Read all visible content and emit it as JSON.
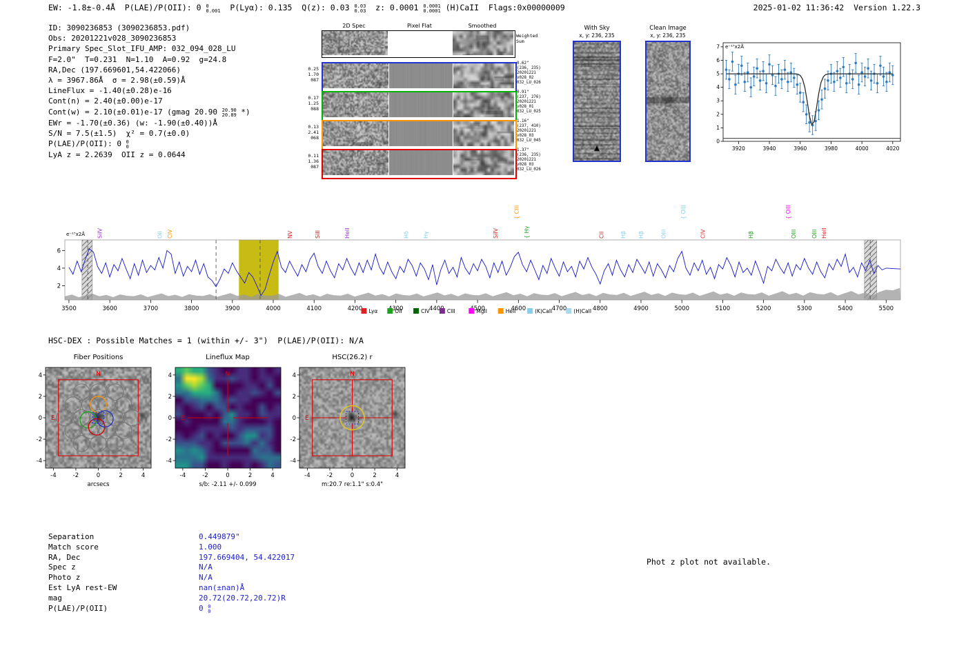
{
  "meta": {
    "datetime": "2025-01-02 11:36:42",
    "version": "Version 1.22.3"
  },
  "header": {
    "segments": [
      {
        "t": "EW: -1.8±-0.4Å  P(LAE)/P(OII): 0 "
      },
      {
        "frac": [
          "0",
          "0.001"
        ]
      },
      {
        "t": "  P(Lyα): 0.135  Q(z): 0.03 "
      },
      {
        "frac": [
          "0.03",
          "0.03"
        ]
      },
      {
        "t": "  z: 0.0001 "
      },
      {
        "frac": [
          "0.0001",
          "0.0001"
        ]
      },
      {
        "t": " (H)CaII  Flags:0x00000009"
      }
    ]
  },
  "info": {
    "lines": [
      [
        {
          "t": "ID: 3090236853 (3090236853.pdf)"
        }
      ],
      [
        {
          "t": "Obs: 20201221v028_3090236853"
        }
      ],
      [
        {
          "t": "Primary Spec_Slot_IFU_AMP: 032_094_028_LU"
        }
      ],
      [
        {
          "t": "F=2.0\"  T=0.231  N=1.10  A=0.92  g=24.8"
        }
      ],
      [
        {
          "t": "RA,Dec (197.669601,54.422066)"
        }
      ],
      [
        {
          "t": "λ = 3967.86Å  σ = 2.98(±0.59)Å"
        }
      ],
      [
        {
          "t": "LineFlux = -1.40(±0.28)e-16"
        }
      ],
      [
        {
          "t": "Cont(n) = 2.40(±0.00)e-17"
        }
      ],
      [
        {
          "t": "Cont(w) = 2.10(±0.01)e-17 (gmag 20.90 "
        },
        {
          "frac": [
            "20.90",
            "20.89"
          ]
        },
        {
          "t": " *)"
        }
      ],
      [
        {
          "t": "EWr = -1.70(±0.36) (w: -1.90(±0.40))Å"
        }
      ],
      [
        {
          "t": "S/N = 7.5(±1.5)  χ² = 0.7(±0.0)"
        }
      ],
      [
        {
          "t": "P(LAE)/P(OII): 0 "
        },
        {
          "frac": [
            "0",
            "0"
          ]
        }
      ],
      [
        {
          "t": "LyA z = 2.2639  OII z = 0.0644"
        }
      ]
    ]
  },
  "cutouts2d": {
    "col_headers": [
      "2D Spec",
      "Pixel Flat",
      "Smoothed"
    ],
    "weighted_label": [
      "Weighted",
      "Sum"
    ],
    "rows": [
      {
        "border": "#2233cc",
        "left": [
          "0.25",
          "1.70",
          "087"
        ],
        "right": [
          "0.62\"",
          "(236, 235)",
          "20201221",
          "v028_02",
          "032_LU_026"
        ]
      },
      {
        "border": "#00b400",
        "left": [
          "0.17",
          "1.25",
          "088"
        ],
        "right": [
          "0.91\"",
          "(237, 276)",
          "20201221",
          "v028_01",
          "032_LU_025"
        ]
      },
      {
        "border": "#ff9500",
        "left": [
          "0.13",
          "2.41",
          "068"
        ],
        "right": [
          "1.16\"",
          "(237, 410)",
          "20201221",
          "v028_03",
          "032_LU_045"
        ]
      },
      {
        "border": "#e00000",
        "left": [
          "0.11",
          "1.36",
          "087"
        ],
        "right": [
          "1.37\"",
          "(236, 235)",
          "20201221",
          "v028_03",
          "032_LU_026"
        ]
      }
    ]
  },
  "sky_panels": [
    {
      "title": "With Sky",
      "subtitle": "x, y: 236, 235"
    },
    {
      "title": "Clean Image",
      "subtitle": "x, y: 236, 235"
    }
  ],
  "hsc_line": "HSC-DEX : Possible Matches = 1 (within +/- 3\")  P(LAE)/P(OII): N/A",
  "cutouts": {
    "ticks": [
      -4,
      -2,
      0,
      2,
      4
    ],
    "compass": {
      "north": "N",
      "east": "E"
    },
    "panels": [
      {
        "title": "Fiber Positions",
        "xlabel": "arcsecs",
        "type": "fiber"
      },
      {
        "title": "Lineflux Map",
        "xlabel": "s/b: -2.11 +/- 0.099",
        "type": "lineflux"
      },
      {
        "title": "HSC(26.2) r",
        "xlabel": "m:20.7 re:1.1\" s:0.4\"",
        "type": "hsc"
      }
    ]
  },
  "match_table": {
    "rows": [
      {
        "label": "Separation",
        "value": "0.449879\""
      },
      {
        "label": "Match score",
        "value": "1.000"
      },
      {
        "label": "RA, Dec",
        "value": "197.669404, 54.422017"
      },
      {
        "label": "Spec z",
        "value": "N/A"
      },
      {
        "label": "Photo z",
        "value": "N/A"
      },
      {
        "label": "Est LyA rest-EW",
        "value": "nan(±nan)Å"
      },
      {
        "label": "mag",
        "value": "20.72(20.72,20.72)R"
      },
      {
        "label": "P(LAE)/P(OII)",
        "value": "0 ",
        "frac": [
          "0",
          "0"
        ]
      }
    ]
  },
  "photz_note": "Phot z plot not available.",
  "chart_data": [
    {
      "type": "scatter",
      "title": "line fit inset",
      "ylabel_annotation": "e⁻¹⁷x2Å",
      "xlim": [
        3910,
        4025
      ],
      "ylim": [
        0,
        7.3
      ],
      "xticks": [
        3920,
        3940,
        3960,
        3980,
        4000,
        4020
      ],
      "yticks": [
        0,
        1,
        2,
        3,
        4,
        5,
        6,
        7
      ],
      "x_start": 3912,
      "x_step": 2,
      "y": [
        5.3,
        4.6,
        5.9,
        4.2,
        5.0,
        5.6,
        4.4,
        5.1,
        4.0,
        4.8,
        5.4,
        4.5,
        5.2,
        4.3,
        5.7,
        4.9,
        4.1,
        5.0,
        4.6,
        5.3,
        4.4,
        5.1,
        4.7,
        4.2,
        3.6,
        2.9,
        2.0,
        1.4,
        1.2,
        1.5,
        2.3,
        3.1,
        3.9,
        4.5,
        5.0,
        4.4,
        5.2,
        4.7,
        5.5,
        4.3,
        5.0,
        4.6,
        5.8,
        4.2,
        5.1,
        4.8,
        5.4,
        4.5,
        5.0,
        4.3,
        5.6,
        4.8,
        4.4,
        5.1,
        4.9
      ],
      "yerr": 0.7,
      "fit": {
        "continuum": 5.0,
        "center": 3967.86,
        "sigma": 2.98,
        "depth": 3.8
      },
      "zero_line": 0.22,
      "point_color": "#2d7bbf",
      "fit_color": "#2a2a2a"
    },
    {
      "type": "line",
      "title": "full spectrum",
      "ylabel_annotation": "e⁻¹⁷x2Å",
      "xlim": [
        3490,
        5535
      ],
      "ylim": [
        0.4,
        7.2
      ],
      "xticks": [
        3500,
        3600,
        3700,
        3800,
        3900,
        4000,
        4100,
        4200,
        4300,
        4400,
        4500,
        4600,
        4700,
        4800,
        4900,
        5000,
        5100,
        5200,
        5300,
        5400,
        5500
      ],
      "yticks": [
        2,
        4,
        6
      ],
      "x_start": 3500,
      "x_step": 10,
      "values": [
        4.1,
        3.3,
        4.8,
        3.6,
        5.0,
        6.2,
        5.8,
        4.2,
        3.4,
        4.6,
        3.0,
        4.4,
        3.7,
        5.1,
        3.9,
        2.8,
        4.5,
        3.2,
        4.9,
        3.5,
        4.3,
        3.8,
        5.2,
        4.0,
        6.0,
        5.6,
        3.4,
        4.7,
        3.1,
        4.2,
        3.6,
        4.9,
        3.3,
        4.5,
        3.0,
        2.6,
        1.9,
        2.8,
        3.9,
        3.4,
        4.6,
        3.7,
        3.0,
        2.3,
        3.5,
        3.0,
        2.0,
        0.9,
        1.6,
        3.2,
        4.7,
        5.9,
        4.1,
        3.5,
        4.8,
        3.9,
        3.1,
        4.4,
        3.6,
        5.0,
        5.7,
        4.2,
        3.4,
        4.8,
        3.7,
        2.9,
        4.5,
        3.8,
        5.1,
        4.0,
        3.2,
        4.6,
        3.5,
        4.9,
        3.8,
        5.6,
        4.1,
        3.3,
        4.7,
        3.6,
        2.8,
        4.2,
        3.5,
        5.0,
        4.3,
        3.1,
        4.6,
        3.9,
        2.7,
        4.4,
        2.1,
        3.8,
        4.9,
        3.4,
        4.1,
        3.0,
        5.2,
        4.0,
        3.3,
        4.5,
        3.7,
        5.0,
        4.2,
        2.9,
        4.6,
        3.5,
        4.8,
        3.2,
        4.1,
        5.3,
        5.8,
        4.4,
        3.6,
        4.9,
        3.8,
        2.7,
        4.3,
        3.4,
        5.1,
        4.0,
        3.1,
        4.7,
        3.6,
        4.2,
        3.0,
        4.8,
        3.9,
        5.2,
        4.1,
        3.3,
        2.2,
        3.7,
        4.5,
        3.2,
        4.9,
        3.8,
        3.0,
        4.4,
        3.5,
        5.0,
        4.2,
        3.4,
        4.7,
        3.1,
        4.5,
        3.8,
        2.9,
        4.3,
        3.6,
        5.1,
        5.9,
        4.0,
        3.2,
        4.6,
        3.7,
        4.9,
        3.3,
        4.1,
        2.8,
        4.4,
        3.9,
        5.2,
        4.3,
        3.0,
        4.7,
        3.5,
        4.0,
        3.2,
        4.8,
        3.6,
        2.3,
        4.2,
        3.7,
        5.0,
        4.1,
        3.4,
        4.6,
        3.1,
        4.4,
        3.8,
        5.1,
        4.0,
        3.3,
        4.7,
        3.6,
        2.9,
        4.5,
        3.8,
        5.0,
        4.2,
        5.6,
        3.5,
        4.1,
        3.0,
        4.6,
        3.7,
        4.9,
        3.4,
        4.3,
        3.8,
        4.0
      ],
      "noise_profile": [
        0.8,
        1.0,
        0.7,
        0.9,
        1.1,
        0.8,
        0.95,
        0.7,
        1.0,
        0.85
      ],
      "line_color": "#1414cc",
      "highlight_band": {
        "x0": 3916,
        "x1": 4013,
        "color": "#c3b500"
      },
      "masked_bands": [
        {
          "x0": 3532,
          "x1": 3557
        },
        {
          "x0": 5447,
          "x1": 5477
        }
      ],
      "dashed_lines": [
        3546,
        3860,
        3967.86,
        5461
      ],
      "line_labels": [
        {
          "label": "SiIV",
          "color": "#9932cc",
          "wl": 3580
        },
        {
          "label": "OII",
          "color": "#87ceeb",
          "wl": 3727
        },
        {
          "label": "CIV",
          "color": "#ff9500",
          "wl": 3752
        },
        {
          "label": "NV",
          "color": "#dd2222",
          "wl": 4046
        },
        {
          "label": "SiII",
          "color": "#b22222",
          "wl": 4113
        },
        {
          "label": "HeII",
          "color": "#9932cc",
          "wl": 4186
        },
        {
          "label": "Hδ",
          "color": "#87ceeb",
          "wl": 4330
        },
        {
          "label": "Hγ",
          "color": "#87ceeb",
          "wl": 4378
        },
        {
          "label": "SiIV",
          "color": "#dd2222",
          "wl": 4549
        },
        {
          "label": "CIII",
          "color": "#ff9500",
          "wl": 4600,
          "row": "high",
          "brace": true
        },
        {
          "label": "Hγ",
          "color": "#1fa01f",
          "wl": 4625,
          "brace": true
        },
        {
          "label": "CII",
          "color": "#b22222",
          "wl": 4808
        },
        {
          "label": "Hβ",
          "color": "#87ceeb",
          "wl": 4861
        },
        {
          "label": "Hβ",
          "color": "#87ceeb",
          "wl": 4905
        },
        {
          "label": "OIII",
          "color": "#87ceeb",
          "wl": 4960
        },
        {
          "label": "OIII",
          "color": "#87ceeb",
          "wl": 5008,
          "row": "high",
          "brace": true
        },
        {
          "label": "CIV",
          "color": "#dd2222",
          "wl": 5056
        },
        {
          "label": "Hβ",
          "color": "#1fa01f",
          "wl": 5174
        },
        {
          "label": "OIII",
          "color": "#ff00ff",
          "wl": 5265,
          "row": "high",
          "brace": true
        },
        {
          "label": "OIII",
          "color": "#1fa01f",
          "wl": 5278
        },
        {
          "label": "OIII",
          "color": "#1fa01f",
          "wl": 5329
        },
        {
          "label": "HeII",
          "color": "#dd2222",
          "wl": 5353
        }
      ],
      "legend": [
        {
          "label": "Lyα",
          "color": "#dd2222"
        },
        {
          "label": "OII",
          "color": "#1fa01f"
        },
        {
          "label": "CIV",
          "color": "#006400"
        },
        {
          "label": "CIII",
          "color": "#7b2d8b"
        },
        {
          "label": "MgII",
          "color": "#ff00ff"
        },
        {
          "label": "HeII",
          "color": "#ff9500"
        },
        {
          "label": "(K)CaII",
          "color": "#87ceeb"
        },
        {
          "label": "(H)CaII",
          "color": "#a8d8ea"
        }
      ]
    }
  ]
}
